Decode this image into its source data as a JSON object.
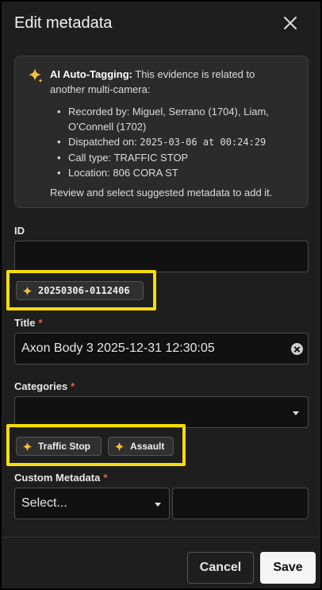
{
  "header": {
    "title": "Edit metadata",
    "close_icon": "close-icon"
  },
  "ai_box": {
    "heading_bold": "AI Auto-Tagging:",
    "heading_rest": " This evidence is related to another multi-camera:",
    "items": [
      {
        "text": "Recorded by: Miguel, Serrano (1704), Liam, O’Connell (1702)"
      },
      {
        "prefix": "Dispatched on: ",
        "value": "2025-03-06 at 00:24:29"
      },
      {
        "text": "Call type: TRAFFIC STOP"
      },
      {
        "text": "Location: 806 CORA ST"
      }
    ],
    "footer": "Review and select suggested metadata to add it."
  },
  "id_field": {
    "label": "ID",
    "value": "",
    "suggestion": "20250306-0112406"
  },
  "title_field": {
    "label": "Title",
    "required_mark": "*",
    "value": "Axon Body 3 2025-12-31 12:30:05"
  },
  "categories_field": {
    "label": "Categories",
    "required_mark": "*",
    "value": "",
    "suggestions": [
      "Traffic Stop",
      "Assault"
    ]
  },
  "custom_metadata": {
    "label": "Custom Metadata",
    "required_mark": "*",
    "select_placeholder": "Select...",
    "value": ""
  },
  "footer": {
    "cancel_label": "Cancel",
    "save_label": "Save"
  },
  "colors": {
    "highlight": "#f5dd0a",
    "required": "#e0605a",
    "sparkle": "#f0c040"
  }
}
